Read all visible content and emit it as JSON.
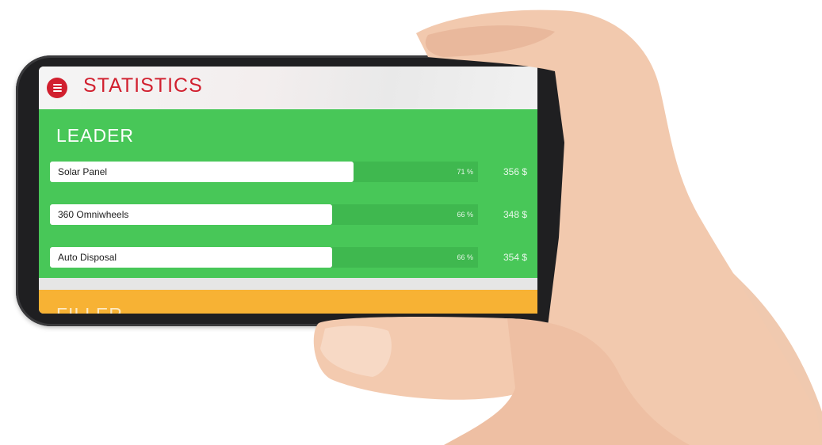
{
  "app": {
    "title": "STATISTICS"
  },
  "leader": {
    "title": "LEADER",
    "items": [
      {
        "name": "Solar Panel",
        "percent_label": "71 %",
        "percent": 71,
        "price": "356 $"
      },
      {
        "name": "360 Omniwheels",
        "percent_label": "66 %",
        "percent": 66,
        "price": "348 $"
      },
      {
        "name": "Auto Disposal",
        "percent_label": "66 %",
        "percent": 66,
        "price": "354 $"
      }
    ]
  },
  "filler": {
    "title": "FILLER"
  },
  "colors": {
    "accent": "#d11f2e",
    "leader_bg": "#48c758",
    "filler_bg": "#f7b234"
  },
  "icons": {
    "menu": "hamburger-menu-icon"
  }
}
